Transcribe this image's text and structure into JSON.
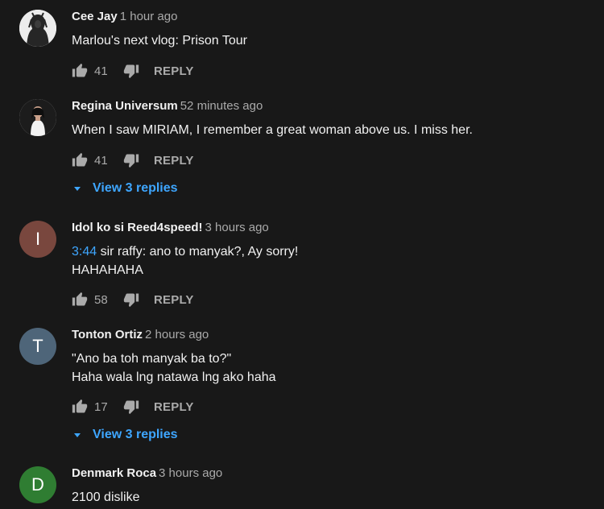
{
  "comments": [
    {
      "author": "Cee Jay",
      "time": "1 hour ago",
      "text_lines": [
        "Marlou's next vlog: Prison Tour"
      ],
      "likes": "41",
      "reply_label": "REPLY",
      "avatar": {
        "type": "photo",
        "icon": "dark-figure-photo"
      }
    },
    {
      "author": "Regina Universum",
      "time": "52 minutes ago",
      "text_lines": [
        "When I saw MIRIAM, I remember a great woman above us. I miss her."
      ],
      "likes": "41",
      "reply_label": "REPLY",
      "view_replies": "View 3 replies",
      "avatar": {
        "type": "photo",
        "icon": "woman-in-white-photo"
      }
    },
    {
      "author": "Idol ko si Reed4speed!",
      "time": "3 hours ago",
      "timestamp_link": "3:44",
      "text_lines": [
        " sir raffy: ano to manyak?, Ay sorry!",
        "HAHAHAHA"
      ],
      "likes": "58",
      "reply_label": "REPLY",
      "avatar": {
        "type": "letter",
        "letter": "I",
        "color": "#79473e"
      }
    },
    {
      "author": "Tonton Ortiz",
      "time": "2 hours ago",
      "text_lines": [
        "\"Ano ba toh manyak ba to?\"",
        "Haha wala lng natawa lng ako haha"
      ],
      "likes": "17",
      "reply_label": "REPLY",
      "view_replies": "View 3 replies",
      "avatar": {
        "type": "letter",
        "letter": "T",
        "color": "#4e6579"
      }
    },
    {
      "author": "Denmark Roca",
      "time": "3 hours ago",
      "text_lines": [
        "2100 dislike"
      ],
      "avatar": {
        "type": "letter",
        "letter": "D",
        "color": "#2f7d32"
      }
    }
  ],
  "colors": {
    "background": "#181818",
    "link": "#3ea6ff",
    "secondary_text": "#aaaaaa"
  }
}
